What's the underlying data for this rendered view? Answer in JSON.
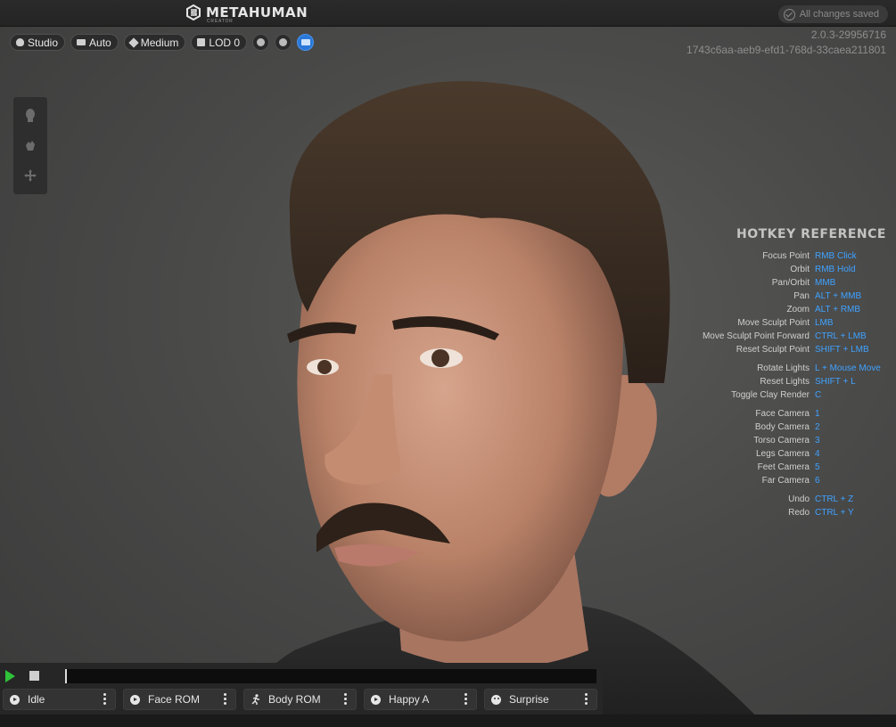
{
  "app": {
    "logo_text": "METAHUMAN",
    "logo_sub": "CREATOR",
    "saved_status": "All changes saved"
  },
  "toolbar": {
    "lighting": "Studio",
    "camera": "Auto",
    "quality": "Medium",
    "lod": "LOD 0"
  },
  "version": {
    "build": "2.0.3-29956716",
    "id": "1743c6aa-aeb9-efd1-768d-33caea211801"
  },
  "hotkeys": {
    "title": "HOTKEY REFERENCE",
    "groups": [
      [
        {
          "action": "Focus Point",
          "key": "RMB Click"
        },
        {
          "action": "Orbit",
          "key": "RMB Hold"
        },
        {
          "action": "Pan/Orbit",
          "key": "MMB"
        },
        {
          "action": "Pan",
          "key": "ALT + MMB"
        },
        {
          "action": "Zoom",
          "key": "ALT + RMB"
        },
        {
          "action": "Move Sculpt Point",
          "key": "LMB"
        },
        {
          "action": "Move Sculpt Point Forward",
          "key": "CTRL + LMB"
        },
        {
          "action": "Reset Sculpt Point",
          "key": "SHIFT + LMB"
        }
      ],
      [
        {
          "action": "Rotate Lights",
          "key": "L + Mouse Move"
        },
        {
          "action": "Reset Lights",
          "key": "SHIFT + L"
        },
        {
          "action": "Toggle Clay Render",
          "key": "C"
        }
      ],
      [
        {
          "action": "Face Camera",
          "key": "1"
        },
        {
          "action": "Body Camera",
          "key": "2"
        },
        {
          "action": "Torso Camera",
          "key": "3"
        },
        {
          "action": "Legs Camera",
          "key": "4"
        },
        {
          "action": "Feet Camera",
          "key": "5"
        },
        {
          "action": "Far Camera",
          "key": "6"
        }
      ],
      [
        {
          "action": "Undo",
          "key": "CTRL + Z"
        },
        {
          "action": "Redo",
          "key": "CTRL + Y"
        }
      ]
    ]
  },
  "animations": [
    {
      "label": "Idle",
      "icon": "play-circle-icon"
    },
    {
      "label": "Face ROM",
      "icon": "play-circle-icon"
    },
    {
      "label": "Body ROM",
      "icon": "running-figure-icon"
    },
    {
      "label": "Happy A",
      "icon": "play-circle-icon"
    },
    {
      "label": "Surprise",
      "icon": "face-icon"
    }
  ],
  "timeline": {
    "progress": 0.0
  },
  "colors": {
    "accent_blue": "#2a78d8",
    "hotkey_blue": "#3fa2ff",
    "play_green": "#2fc23a"
  }
}
